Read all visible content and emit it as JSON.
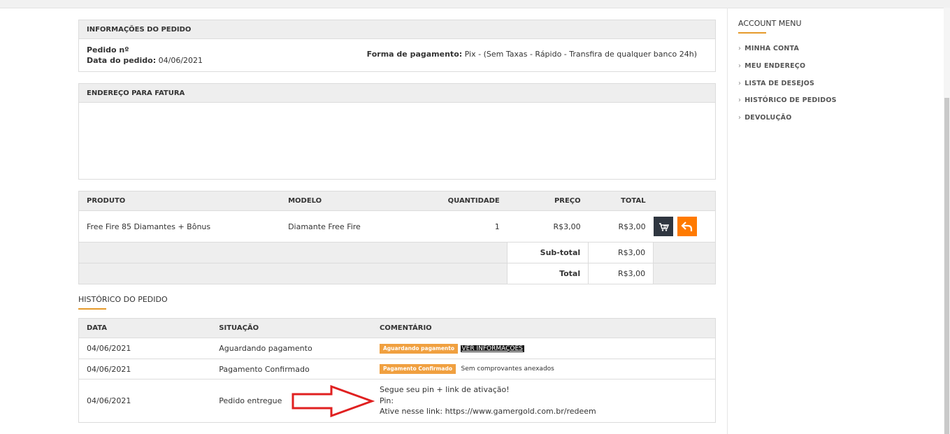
{
  "order_info": {
    "header": "INFORMAÇÕES DO PEDIDO",
    "order_no_label": "Pedido nº",
    "order_date_label": "Data do pedido:",
    "order_date": "04/06/2021",
    "payment_label": "Forma de pagamento:",
    "payment_value": "Pix - (Sem Taxas - Rápido - Transfira de qualquer banco 24h)"
  },
  "billing": {
    "header": "ENDEREÇO PARA FATURA"
  },
  "products": {
    "headers": {
      "product": "PRODUTO",
      "model": "MODELO",
      "quantity": "QUANTIDADE",
      "price": "PREÇO",
      "total": "TOTAL"
    },
    "rows": [
      {
        "product": "Free Fire 85 Diamantes + Bônus",
        "model": "Diamante Free Fire",
        "quantity": "1",
        "price": "R$3,00",
        "total": "R$3,00"
      }
    ],
    "subtotal_label": "Sub-total",
    "subtotal_value": "R$3,00",
    "total_label": "Total",
    "total_value": "R$3,00",
    "reorder_icon": "cart-plus-icon",
    "return_icon": "reply-arrow-icon"
  },
  "history": {
    "title": "HISTÓRICO DO PEDIDO",
    "headers": {
      "date": "DATA",
      "status": "SITUAÇÃO",
      "comment": "COMENTÁRIO"
    },
    "rows": [
      {
        "date": "04/06/2021",
        "status": "Aguardando pagamento",
        "badge": "Aguardando pagamento",
        "link": "VER INFORMAÇÕES"
      },
      {
        "date": "04/06/2021",
        "status": "Pagamento Confirmado",
        "badge": "Pagamento Confirmado",
        "note": "Sem comprovantes anexados"
      },
      {
        "date": "04/06/2021",
        "status": "Pedido entregue",
        "lines": [
          "Segue seu pin + link de ativação!",
          "Pin:",
          "Ative nesse link: https://www.gamergold.com.br/redeem"
        ]
      }
    ],
    "annotation_icon": "red-arrow-icon"
  },
  "account_menu": {
    "title": "ACCOUNT MENU",
    "items": [
      "MINHA CONTA",
      "MEU ENDEREÇO",
      "LISTA DE DESEJOS",
      "HISTÓRICO DE PEDIDOS",
      "DEVOLUÇÃO"
    ]
  },
  "colors": {
    "accent": "#ff7a00",
    "dark_button": "#2f3640",
    "badge": "#f0a040",
    "arrow": "#e02020"
  }
}
